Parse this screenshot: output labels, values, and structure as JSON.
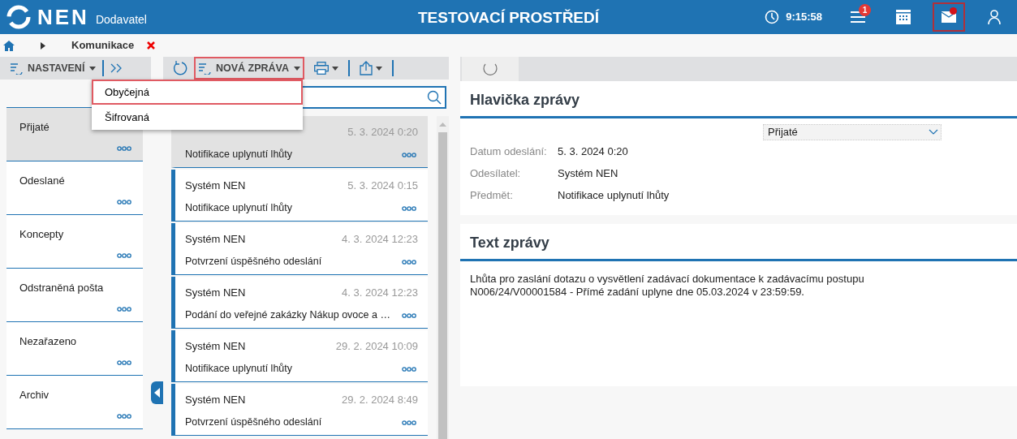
{
  "header": {
    "logo": "NEN",
    "logo_subtitle": "Dodavatel",
    "title": "TESTOVACÍ PROSTŘEDÍ",
    "time": "9:15:58",
    "notification_count": "1",
    "mail_unread": true,
    "mail_highlighted": true
  },
  "breadcrumb": {
    "current": "Komunikace"
  },
  "folder_toolbar": {
    "settings_label": "NASTAVENÍ"
  },
  "folders": [
    {
      "label": "Přijaté",
      "selected": true
    },
    {
      "label": "Odeslané",
      "selected": false
    },
    {
      "label": "Koncepty",
      "selected": false
    },
    {
      "label": "Odstraněná pošta",
      "selected": false
    },
    {
      "label": "Nezařazeno",
      "selected": false
    },
    {
      "label": "Archiv",
      "selected": false
    }
  ],
  "message_toolbar": {
    "new_message_label": "NOVÁ ZPRÁVA",
    "new_message_highlighted": true
  },
  "new_message_menu": [
    {
      "label": "Obyčejná",
      "highlighted": true
    },
    {
      "label": "Šifrovaná",
      "highlighted": false
    }
  ],
  "messages": [
    {
      "date": "5. 3. 2024 0:20",
      "subject": "Notifikace uplynutí lhůty",
      "selected": true
    },
    {
      "sender": "Systém NEN",
      "date": "5. 3. 2024 0:15",
      "subject": "Notifikace uplynutí lhůty",
      "selected": false
    },
    {
      "sender": "Systém NEN",
      "date": "4. 3. 2024 12:23",
      "subject": "Potvrzení úspěšného odeslání",
      "selected": false
    },
    {
      "sender": "Systém NEN",
      "date": "4. 3. 2024 12:23",
      "subject": "Podání do veřejné zakázky Nákup ovoce a …",
      "selected": false
    },
    {
      "sender": "Systém NEN",
      "date": "29. 2. 2024 10:09",
      "subject": "Notifikace uplynutí lhůty",
      "selected": false
    },
    {
      "sender": "Systém NEN",
      "date": "29. 2. 2024 8:49",
      "subject": "Potvrzení úspěšného odeslání",
      "selected": false
    }
  ],
  "detail": {
    "header_title": "Hlavička zprávy",
    "folder_select": "Přijaté",
    "fields": [
      {
        "label": "Datum odeslání:",
        "value": "5. 3. 2024 0:20"
      },
      {
        "label": "Odesílatel:",
        "value": "Systém NEN"
      },
      {
        "label": "Předmět:",
        "value": "Notifikace uplynutí lhůty"
      }
    ],
    "text_title": "Text zprávy",
    "body": "Lhůta pro zaslání dotazu o vysvětlení zadávací dokumentace k zadávacímu postupu\nN006/24/V00001584 - Přímé zadání uplyne dne 05.03.2024 v 23:59:59."
  }
}
